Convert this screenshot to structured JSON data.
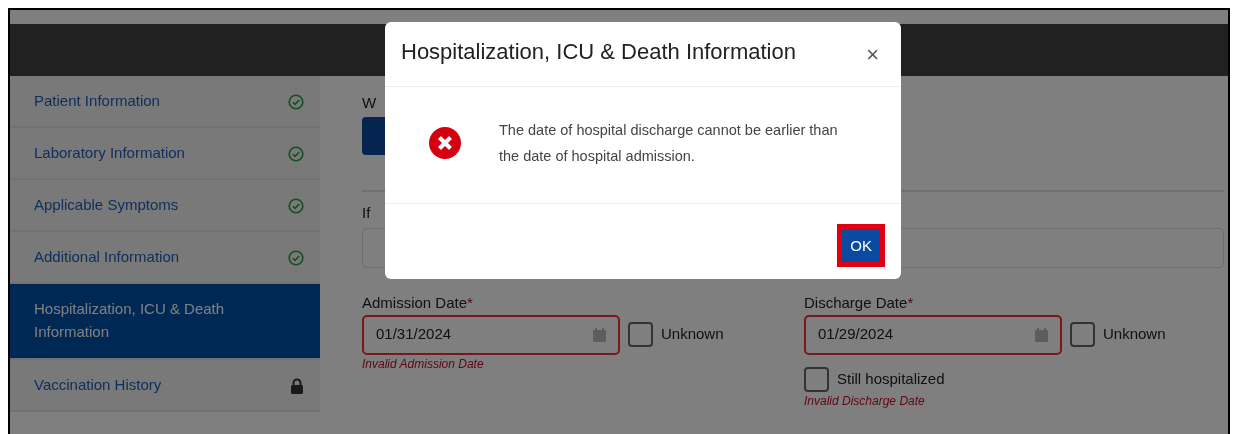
{
  "sidebar": {
    "items": [
      {
        "label": "Patient Information",
        "selected": false,
        "kind": "complete"
      },
      {
        "label": "Laboratory Information",
        "selected": false,
        "kind": "complete"
      },
      {
        "label": "Applicable Symptoms",
        "selected": false,
        "kind": "complete"
      },
      {
        "label": "Additional Information",
        "selected": false,
        "kind": "complete"
      },
      {
        "label": "Hospitalization, ICU & Death Information",
        "selected": true,
        "kind": "current"
      },
      {
        "label": "Vaccination History",
        "selected": false,
        "kind": "locked"
      }
    ]
  },
  "form": {
    "partial_texts": [
      "W",
      "If"
    ],
    "dates": [
      {
        "label": "Admission Date",
        "required_mark": "*",
        "value": "01/31/2024",
        "invalid": true,
        "unknown": {
          "label": "Unknown",
          "checked": false
        },
        "error": "Invalid Admission Date"
      },
      {
        "label": "Discharge Date",
        "required_mark": "*",
        "value": "01/29/2024",
        "invalid": true,
        "unknown": {
          "label": "Unknown",
          "checked": false
        },
        "extra": {
          "label": "Still hospitalized",
          "checked": false
        },
        "error": "Invalid Discharge Date"
      }
    ]
  },
  "modal": {
    "title": "Hospitalization, ICU & Death Information",
    "close": "×",
    "message": "The date of hospital discharge cannot be earlier than the date of hospital admission.",
    "kind": "error",
    "button": {
      "label": "OK",
      "highlighted": true
    }
  }
}
